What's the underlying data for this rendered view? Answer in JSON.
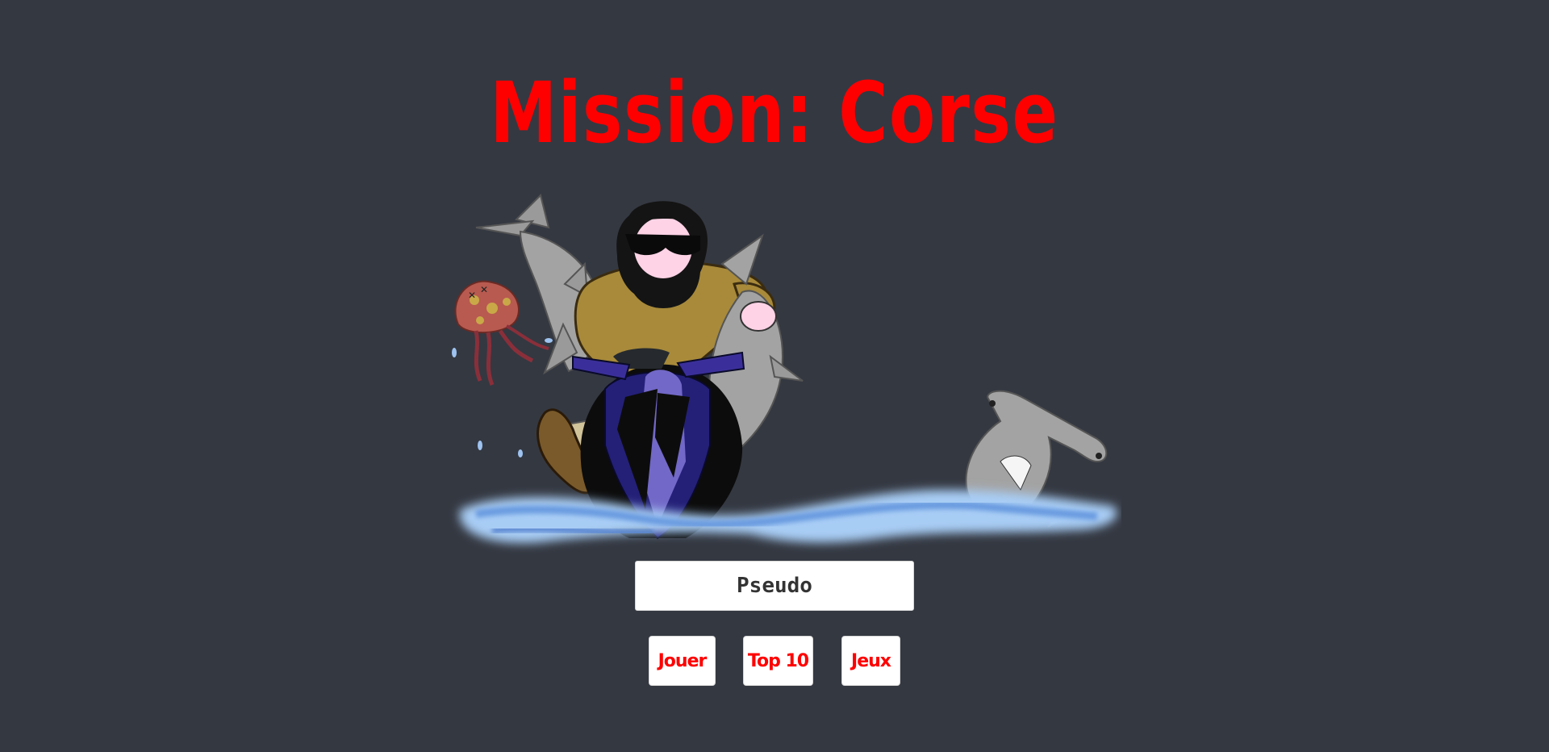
{
  "header": {
    "title": "Mission: Corse"
  },
  "form": {
    "pseudo_value": "Pseudo",
    "pseudo_placeholder": "Pseudo"
  },
  "buttons": {
    "play_label": "Jouer",
    "top10_label": "Top 10",
    "games_label": "Jeux"
  },
  "colors": {
    "background": "#343841",
    "accent": "#ff0000",
    "button_bg": "#ffffff"
  }
}
